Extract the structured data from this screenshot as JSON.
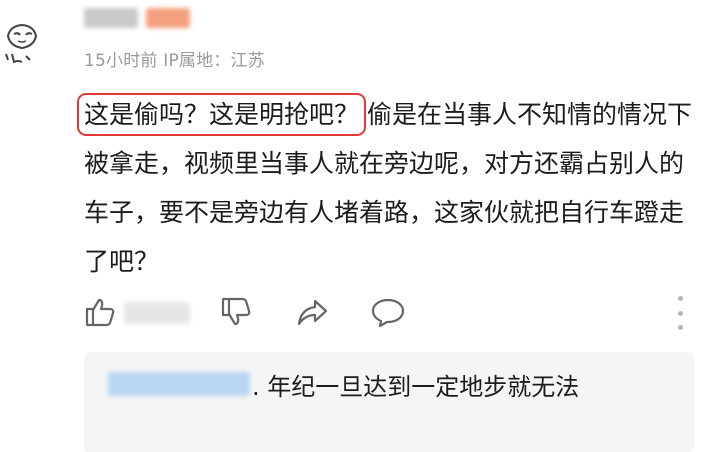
{
  "comment": {
    "meta": "15小时前 IP属地：江苏",
    "quote": "这是偷吗？这是明抢吧？",
    "body": "偷是在当事人不知情的情况下被拿走，视频里当事人就在旁边呢，对方还霸占别人的车子，要不是旁边有人堵着路，这家伙就把自行车蹬走了吧？"
  },
  "actions": {
    "icons": [
      "thumbs-up-icon",
      "thumbs-down-icon",
      "share-icon",
      "comment-icon",
      "more-icon"
    ]
  },
  "reply": {
    "text": ". 年纪一旦达到一定地步就无法"
  },
  "colors": {
    "highlight": "#e53935",
    "meta": "#9a9a9a",
    "reply_bg": "#f5f5f5",
    "icon": "#666666"
  }
}
